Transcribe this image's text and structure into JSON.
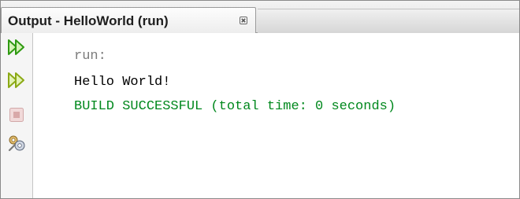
{
  "tab": {
    "title": "Output - HelloWorld (run)",
    "close_icon": "close-icon"
  },
  "toolbar": {
    "items": [
      {
        "name": "rerun-icon"
      },
      {
        "name": "rerun-with-options-icon"
      },
      {
        "name": "stop-icon"
      },
      {
        "name": "settings-icon"
      }
    ]
  },
  "output": {
    "lines": [
      "run:",
      "Hello World!",
      "BUILD SUCCESSFUL (total time: 0 seconds)"
    ]
  },
  "colors": {
    "run_line": "#7c7c7c",
    "stdout": "#000000",
    "success": "#00881d",
    "run_icon": "#3cb013"
  }
}
